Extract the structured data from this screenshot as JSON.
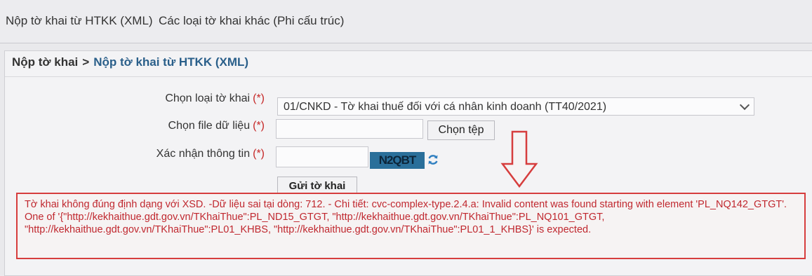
{
  "topnav": {
    "items": [
      "Nộp tờ khai từ HTKK (XML)",
      "Các loại tờ khai khác (Phi cấu trúc)"
    ]
  },
  "breadcrumb": {
    "root": "Nộp tờ khai",
    "separator": ">",
    "current": "Nộp tờ khai từ HTKK (XML)"
  },
  "form": {
    "required_mark": "(*)",
    "declaration_type_label": "Chọn loại tờ khai",
    "declaration_type_value": "01/CNKD - Tờ khai thuế đối với cá nhân kinh doanh (TT40/2021)",
    "data_file_label": "Chọn file dữ liệu",
    "choose_file_button": "Chọn tệp",
    "confirm_label": "Xác nhận thông tin",
    "captcha_text": "N2QBT",
    "submit_button": "Gửi tờ khai"
  },
  "error": {
    "message": "Tờ khai không đúng định dạng với XSD. -Dữ liệu sai tại dòng: 712. - Chi tiết: cvc-complex-type.2.4.a: Invalid content was found starting with element 'PL_NQ142_GTGT'. One of '{\"http://kekhaithue.gdt.gov.vn/TKhaiThue\":PL_ND15_GTGT, \"http://kekhaithue.gdt.gov.vn/TKhaiThue\":PL_NQ101_GTGT, \"http://kekhaithue.gdt.gov.vn/TKhaiThue\":PL01_KHBS, \"http://kekhaithue.gdt.gov.vn/TKhaiThue\":PL01_1_KHBS}' is expected."
  },
  "colors": {
    "link_blue": "#2a5f8a",
    "required_red": "#c62828",
    "error_red": "#d63d3d",
    "captcha_bg": "#2a6f9a"
  },
  "icons": [
    "refresh-icon",
    "down-arrow-annotation-icon",
    "chevron-down-icon"
  ]
}
